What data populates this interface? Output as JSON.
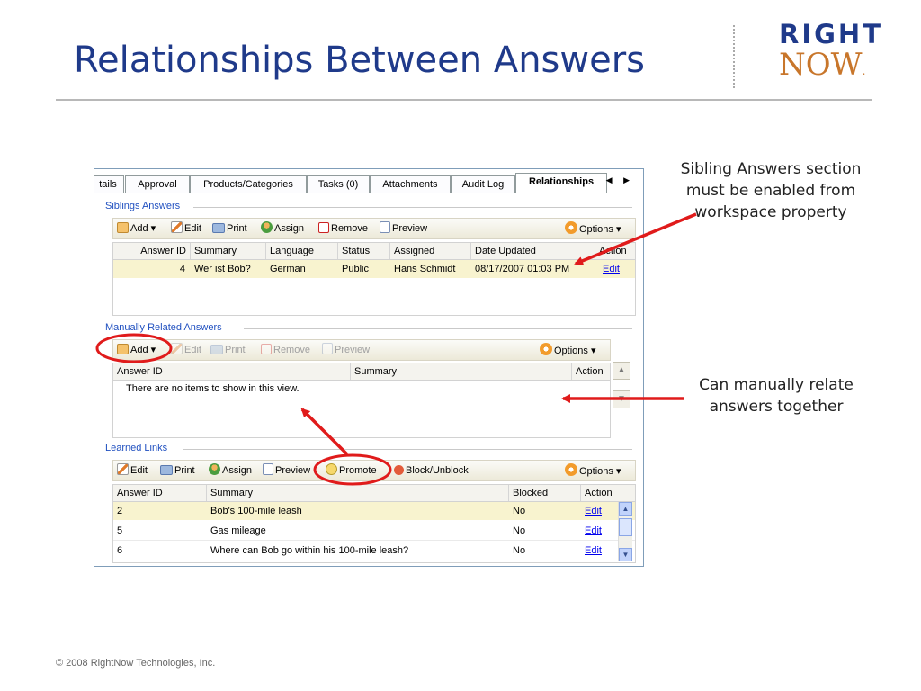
{
  "slide": {
    "title": "Relationships Between Answers",
    "footer": "© 2008 RightNow Technologies, Inc.",
    "logo": {
      "line1": "RIGHT",
      "line2": "NOW",
      "line2_dot": "."
    },
    "colors": {
      "title": "#1f3a8a",
      "logo_now": "#c8762b",
      "annotation": "#e01b1b"
    }
  },
  "callouts": {
    "sibling": "Sibling Answers section must be enabled from workspace property",
    "manual": "Can manually relate answers together"
  },
  "tabs": [
    {
      "label": "tails"
    },
    {
      "label": "Approval"
    },
    {
      "label": "Products/Categories"
    },
    {
      "label": "Tasks (0)"
    },
    {
      "label": "Attachments"
    },
    {
      "label": "Audit Log"
    },
    {
      "label": "Relationships",
      "active": true
    }
  ],
  "tab_arrows": "◀ ▶",
  "siblings": {
    "label": "Siblings Answers",
    "toolbar": {
      "add": "Add",
      "edit": "Edit",
      "print": "Print",
      "assign": "Assign",
      "remove": "Remove",
      "preview": "Preview",
      "options": "Options"
    },
    "columns": [
      "Answer ID",
      "Summary",
      "Language",
      "Status",
      "Assigned",
      "Date Updated",
      "Action"
    ],
    "rows": [
      {
        "id": "4",
        "summary": "Wer ist Bob?",
        "language": "German",
        "status": "Public",
        "assigned": "Hans Schmidt",
        "date": "08/17/2007 01:03 PM",
        "action": "Edit"
      }
    ]
  },
  "manual": {
    "label": "Manually Related Answers",
    "toolbar": {
      "add": "Add",
      "edit": "Edit",
      "print": "Print",
      "remove": "Remove",
      "preview": "Preview",
      "options": "Options"
    },
    "columns": [
      "Answer ID",
      "Summary",
      "Action"
    ],
    "empty": "There are no items to show in this view."
  },
  "learned": {
    "label": "Learned Links",
    "toolbar": {
      "edit": "Edit",
      "print": "Print",
      "assign": "Assign",
      "preview": "Preview",
      "promote": "Promote",
      "block": "Block/Unblock",
      "options": "Options"
    },
    "columns": [
      "Answer ID",
      "Summary",
      "Blocked",
      "Action"
    ],
    "rows": [
      {
        "id": "2",
        "summary": "Bob's 100-mile leash",
        "blocked": "No",
        "action": "Edit"
      },
      {
        "id": "5",
        "summary": "Gas mileage",
        "blocked": "No",
        "action": "Edit"
      },
      {
        "id": "6",
        "summary": "Where can Bob go within his 100-mile leash?",
        "blocked": "No",
        "action": "Edit"
      }
    ]
  }
}
